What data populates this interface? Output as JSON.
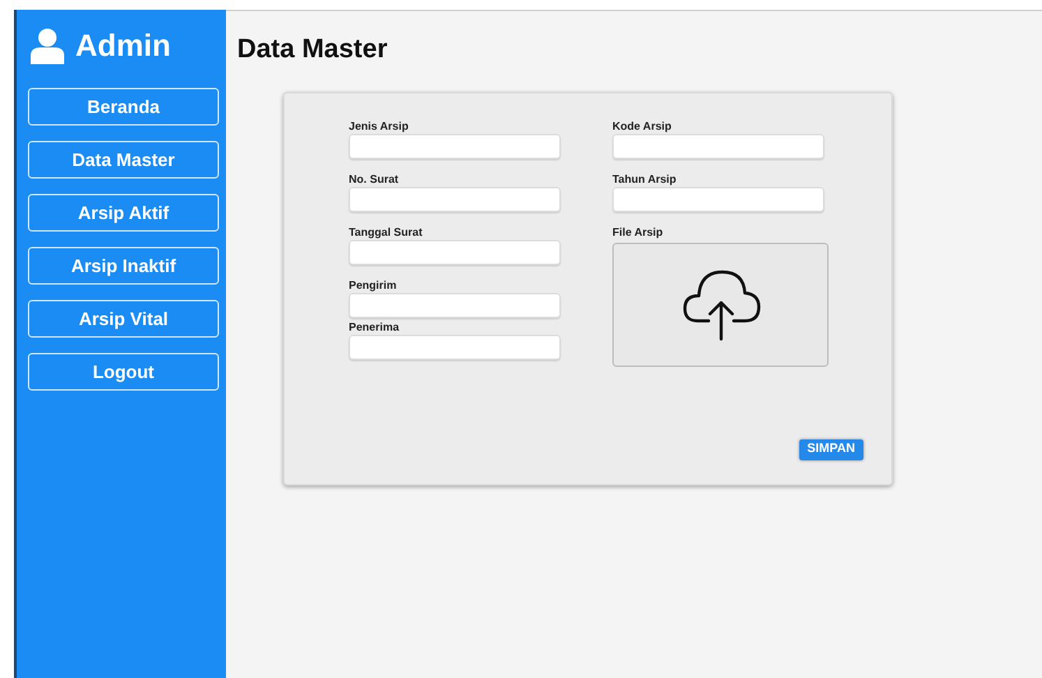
{
  "sidebar": {
    "title": "Admin",
    "items": [
      {
        "label": "Beranda"
      },
      {
        "label": "Data Master"
      },
      {
        "label": "Arsip Aktif"
      },
      {
        "label": "Arsip Inaktif"
      },
      {
        "label": "Arsip Vital"
      },
      {
        "label": "Logout"
      }
    ]
  },
  "page_title": "Data Master",
  "form": {
    "left_fields": [
      {
        "label": "Jenis Arsip"
      },
      {
        "label": "No. Surat"
      },
      {
        "label": "Tanggal Surat"
      },
      {
        "label": "Pengirim"
      },
      {
        "label": "Penerima"
      }
    ],
    "right_fields": [
      {
        "label": "Kode Arsip",
        "kind": "text"
      },
      {
        "label": "Tahun Arsip",
        "kind": "text"
      },
      {
        "label": "File Arsip",
        "kind": "upload"
      }
    ],
    "submit": "SIMPAN"
  }
}
